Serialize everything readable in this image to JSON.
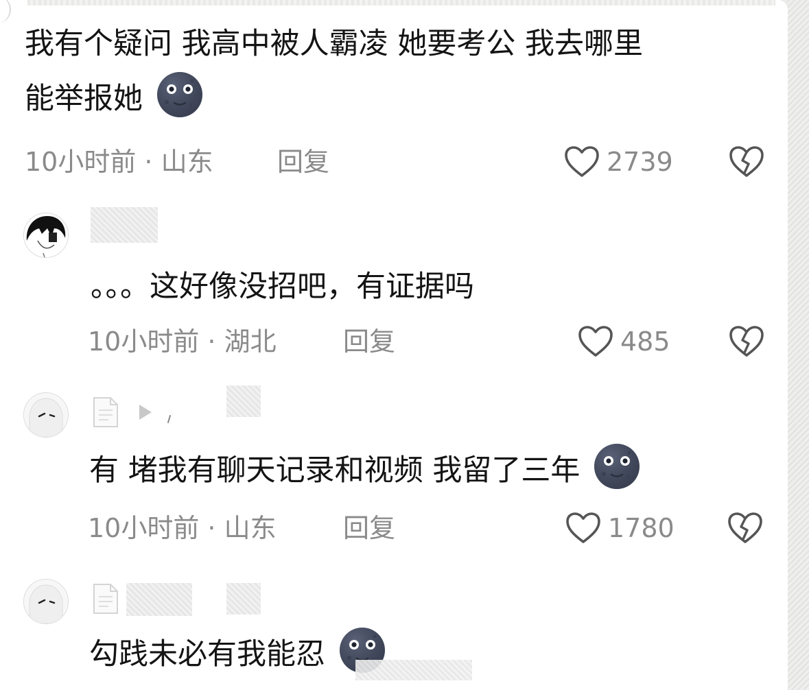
{
  "comments": [
    {
      "text_line1": "我有个疑问 我高中被人霸凌 她要考公 我去哪里",
      "text_line2": "能举报她",
      "emoji": "new-moon-face",
      "meta": "10小时前 · 山东",
      "reply": "回复",
      "likes": "2739"
    },
    {
      "text": "。。。这好像没招吧，有证据吗",
      "meta": "10小时前 · 湖北",
      "reply": "回复",
      "likes": "485"
    },
    {
      "text": "有 堵我有聊天记录和视频 我留了三年",
      "emoji": "new-moon-face",
      "meta": "10小时前 · 山东",
      "reply": "回复",
      "likes": "1780"
    },
    {
      "text": "勾践未必有我能忍",
      "emoji": "new-moon-face"
    }
  ],
  "icons": {
    "like": "heart-outline-icon",
    "dislike": "broken-heart-icon",
    "doc": "document-icon",
    "play": "play-icon"
  },
  "colors": {
    "text": "#141414",
    "meta": "#8a8a8a",
    "icon": "#555555",
    "emoji": "#3f4658"
  }
}
